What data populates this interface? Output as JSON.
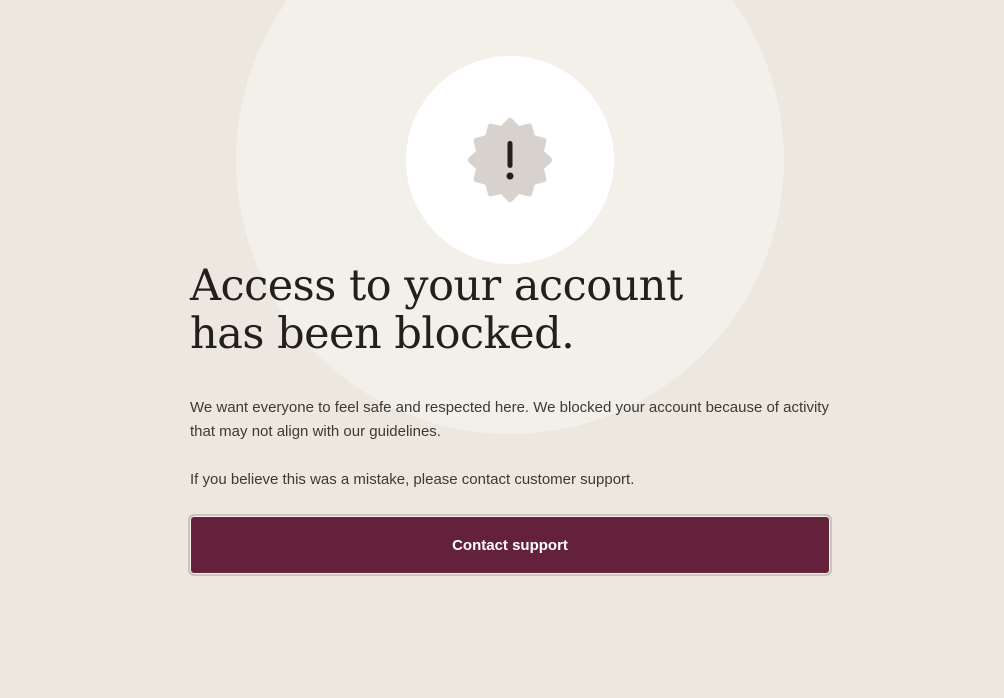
{
  "icons": {
    "status": "alert-badge-icon"
  },
  "colors": {
    "background": "#ece7df",
    "halo": "#f3f0ea",
    "icon_circle": "#ffffff",
    "badge": "#d7d2cd",
    "title_text": "#221f1c",
    "body_text": "#3d3935",
    "button_bg": "#63213b",
    "button_text": "#ffffff"
  },
  "heading": {
    "line1": "Access to your account",
    "line2": "has been blocked."
  },
  "body": {
    "paragraph1": "We want everyone to feel safe and respected here. We blocked your account because of activity that may not align with our guidelines.",
    "paragraph2": "If you believe this was a mistake, please contact customer support."
  },
  "actions": {
    "contact_label": "Contact support"
  }
}
